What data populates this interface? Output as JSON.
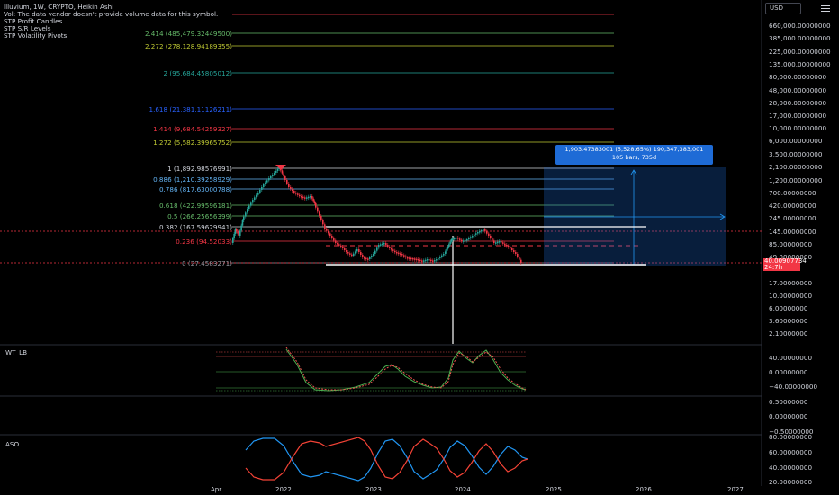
{
  "legend": {
    "title": "Illuvium, 1W, CRYPTO, Heikin Ashi",
    "volume_note": "Vol: The data vendor doesn't provide volume data for this symbol.",
    "indicators": [
      "STP Profit Candles",
      "STP S/R Levels",
      "STP Volatility Pivots"
    ]
  },
  "toolbar": {
    "currency": "USD"
  },
  "price_axis": [
    "660,000.00000000",
    "385,000.00000000",
    "225,000.00000000",
    "135,000.00000000",
    "80,000.00000000",
    "48,000.00000000",
    "28,000.00000000",
    "17,000.00000000",
    "10,000.00000000",
    "6,000.00000000",
    "3,500.00000000",
    "2,100.00000000",
    "1,200.00000000",
    "700.00000000",
    "420.00000000",
    "245.00000000",
    "145.00000000",
    "85.00000000",
    "49.00000000",
    "17.00000000",
    "10.00000000",
    "6.00000000",
    "3.60000000",
    "2.10000000"
  ],
  "price_badge": {
    "price": "40.00907734",
    "countdown": "24:7h"
  },
  "fib_levels": [
    {
      "label": "2.414 (485,479.32449500)",
      "color": "#66bb6a"
    },
    {
      "label": "2.272 (278,128.94189355)",
      "color": "#c0ca33"
    },
    {
      "label": "2 (95,684.45805012)",
      "color": "#26a69a"
    },
    {
      "label": "1.618 (21,381.11126211)",
      "color": "#2962ff"
    },
    {
      "label": "1.414 (9,684.54259327)",
      "color": "#f23645"
    },
    {
      "label": "1.272 (5,582.39965752)",
      "color": "#c0ca33"
    },
    {
      "label": "1 (1,892.98576991)",
      "color": "#d1d4dc"
    },
    {
      "label": "0.886 (1,210.39258929)",
      "color": "#64b5f6"
    },
    {
      "label": "0.786 (817.63000788)",
      "color": "#64b5f6"
    },
    {
      "label": "0.618 (422.99596181)",
      "color": "#66bb6a"
    },
    {
      "label": "0.5 (266.25656399)",
      "color": "#66bb6a"
    },
    {
      "label": "0.382 (167.59629941)",
      "color": "#d1d4dc"
    },
    {
      "label": "0.236 (94.52033)",
      "color": "#f23645"
    },
    {
      "label": "0 (27.4583271)",
      "color": "#9598a1"
    }
  ],
  "measure": {
    "line1": "1,903.47383001 (5,528.65%) 190,347,383,001",
    "line2": "105 bars, 735d"
  },
  "wt_pane": {
    "title": "WT_LB",
    "axis": [
      "40.00000000",
      "0.00000000",
      "−40.00000000"
    ]
  },
  "mid_axis": [
    "0.50000000",
    "0.00000000",
    "−0.50000000"
  ],
  "aso_pane": {
    "title": "ASO",
    "axis": [
      "80.00000000",
      "60.00000000",
      "40.00000000",
      "20.00000000"
    ]
  },
  "time_axis": [
    "Apr",
    "2022",
    "2023",
    "2024",
    "2025",
    "2026",
    "2027"
  ],
  "colors": {
    "bull": "#26a69a",
    "bear": "#f23645",
    "measure": "#1e6bd6",
    "wt_green": "#4caf50",
    "wt_red": "#ef5350",
    "aso_blue": "#2196f3",
    "aso_red": "#f44336"
  }
}
